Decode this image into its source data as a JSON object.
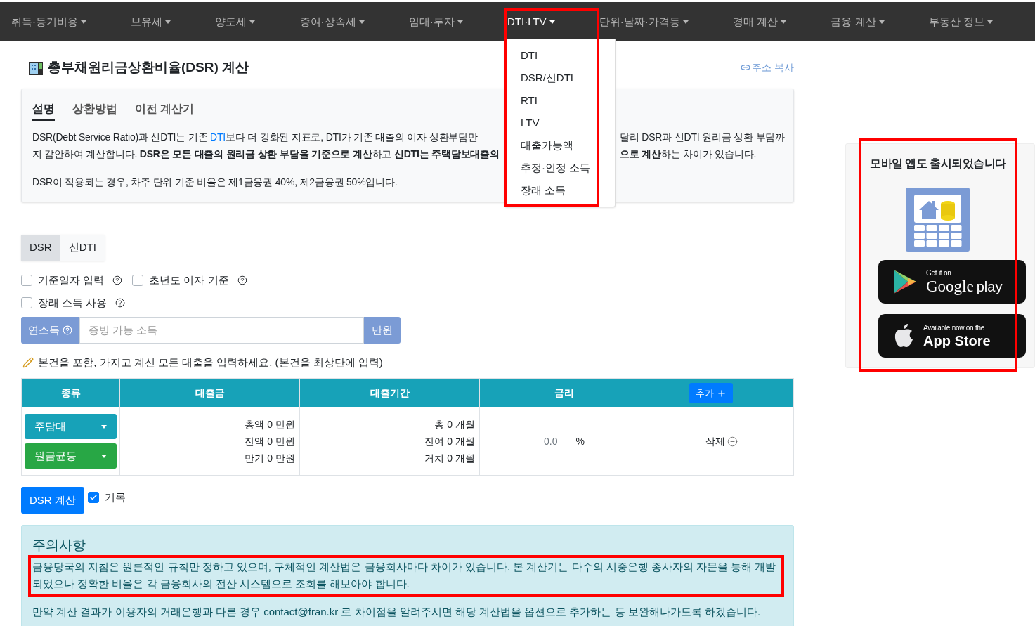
{
  "nav": [
    {
      "label": "취득·등기비용",
      "selected": false
    },
    {
      "label": "보유세",
      "selected": false
    },
    {
      "label": "양도세",
      "selected": false
    },
    {
      "label": "증여·상속세",
      "selected": false
    },
    {
      "label": "임대·투자",
      "selected": false
    },
    {
      "label": "DTI·LTV",
      "selected": true
    },
    {
      "label": "단위·날짜·가격등",
      "selected": false
    },
    {
      "label": "경매 계산",
      "selected": false
    },
    {
      "label": "금융 계산",
      "selected": false
    },
    {
      "label": "부동산 정보",
      "selected": false
    }
  ],
  "dropdown": {
    "highlighted": true,
    "items": [
      "DTI",
      "DSR/신DTI",
      "RTI",
      "LTV",
      "대출가능액",
      "추정·인정 소득",
      "장래 소득"
    ]
  },
  "page_title": "총부채원리금상환비율(DSR) 계산",
  "copy_link": "주소 복사",
  "info_tabs": [
    {
      "label": "설명",
      "selected": true
    },
    {
      "label": "상환방법",
      "selected": false
    },
    {
      "label": "이전 계산기",
      "selected": false
    }
  ],
  "description": [
    {
      "left": "DSR(Debt Service Ratio)과 신DTI는 기존 ",
      "link": "DTI",
      "left_end": "보다 더 강화된 지표로, DTI가 기존 대출의 이자 상환부담만",
      "right": "달리 DSR과 신DTI 원리금 상환 부담까"
    },
    {
      "left": "지 감안하여 계산합니다. **DSR은 모든 대출의 원리금 상환 부담을 기준으로 계산**하고 **신DTI는 주택담보대출의**",
      "right": "**으로 계산**하는 차이가 있습니다."
    }
  ],
  "description_note": "DSR이 적용되는 경우, 차주 단위 기준 비율은 제1금융권 40%, 제2금융권 50%입니다.",
  "mode_toggle": [
    {
      "label": "DSR",
      "selected": true
    },
    {
      "label": "신DTI",
      "selected": false
    }
  ],
  "options": [
    [
      {
        "label": "기준일자 입력",
        "checked": false
      },
      {
        "label": "초년도 이자 기준",
        "checked": false
      }
    ],
    [
      {
        "label": "장래 소득 사용",
        "checked": false
      }
    ]
  ],
  "income": {
    "label": "연소득",
    "placeholder": "증빙 가능 소득",
    "unit": "만원"
  },
  "note": "본건을 포함, 가지고 계신 모든 대출을 입력하세요. (본건을 최상단에 입력)",
  "table": {
    "columns": [
      "종류",
      "대출금",
      "대출기간",
      "금리"
    ],
    "add_button": "추가",
    "rows": [
      {
        "type": "주담대",
        "method": "원금균등",
        "amounts": [
          "총액 0 만원",
          "잔액 0 만원",
          "만기 0 만원"
        ],
        "periods": [
          "총 0 개월",
          "잔여 0 개월",
          "거치 0 개월"
        ],
        "rate": "0.0",
        "rate_unit": "%",
        "delete": "삭제"
      }
    ]
  },
  "calc_button": "DSR 계산",
  "record": {
    "label": "기록",
    "checked": true
  },
  "notice": {
    "title": "주의사항",
    "paragraphs": [
      {
        "text": "금융당국의 지침은 원론적인 규칙만 정하고 있으며, 구체적인 계산법은 금융회사마다 차이가 있습니다. 본 계산기는 다수의 시중은행 종사자의 자문을 통해 개발되었으나 정확한 비율은 각 금융회사의 전산 시스템으로 조회를 해보아야 합니다.",
        "highlighted": true
      },
      {
        "text": "만약 계산 결과가 이용자의 거래은행과 다른 경우 contact@fran.kr 로 차이점을 알려주시면 해당 계산법을 옵션으로 추가하는 등 보완해나가도록 하겠습니다.",
        "highlighted": false
      }
    ]
  },
  "sidebar": {
    "title": "모바일 앱도 출시되었습니다",
    "highlighted": true,
    "badges": [
      {
        "kind": "google",
        "small": "Get it on",
        "big": "Google",
        "suffix": "play"
      },
      {
        "kind": "apple",
        "small": "Available now on the",
        "big": "App Store"
      }
    ]
  }
}
